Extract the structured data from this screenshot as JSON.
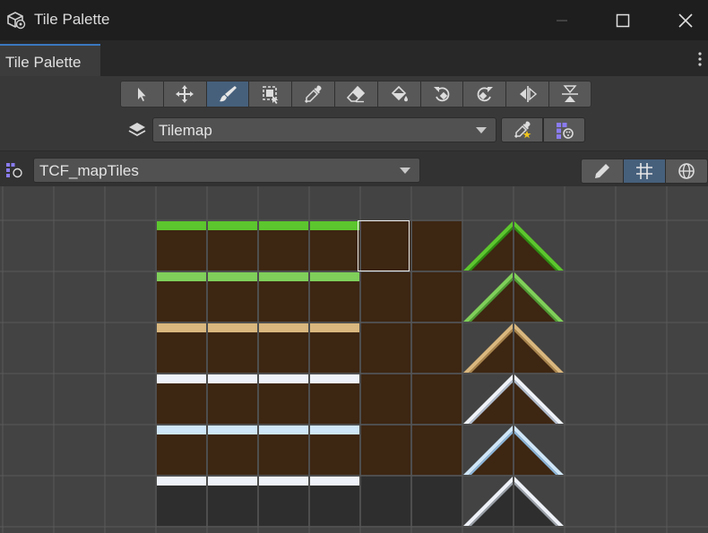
{
  "window": {
    "title": "Tile Palette",
    "controls": {
      "minimize_icon": "minimize-icon",
      "maximize_icon": "maximize-icon",
      "close_icon": "close-icon"
    }
  },
  "tab": {
    "label": "Tile Palette",
    "menu_icon": "kebab-menu-icon"
  },
  "toolbar": {
    "tools": [
      {
        "name": "select-tool",
        "icon": "arrow-cursor-icon"
      },
      {
        "name": "move-tool",
        "icon": "move-arrows-icon"
      },
      {
        "name": "paint-tool",
        "icon": "paintbrush-icon",
        "active": true
      },
      {
        "name": "box-fill-tool",
        "icon": "box-fill-icon"
      },
      {
        "name": "picker-tool",
        "icon": "eyedropper-icon"
      },
      {
        "name": "erase-tool",
        "icon": "eraser-icon"
      },
      {
        "name": "fill-tool",
        "icon": "paint-bucket-icon"
      },
      {
        "name": "rotate-ccw-tool",
        "icon": "rotate-ccw-icon"
      },
      {
        "name": "rotate-cw-tool",
        "icon": "rotate-cw-icon"
      },
      {
        "name": "flip-x-tool",
        "icon": "flip-horizontal-icon"
      },
      {
        "name": "flip-y-tool",
        "icon": "flip-vertical-icon"
      }
    ]
  },
  "tilemap": {
    "selected": "Tilemap",
    "layer_icon": "layers-icon"
  },
  "palette": {
    "selected": "TCF_mapTiles",
    "edit_icon": "pencil-icon",
    "grid_icon": "grid-icon",
    "gizmo_icon": "gizmo-globe-icon"
  },
  "tile_rows": [
    {
      "theme": "grass",
      "surface": "#5cc62e",
      "edge": "#2e8a12"
    },
    {
      "theme": "pale-grass",
      "surface": "#7fcf5a",
      "edge": "#4e9a34"
    },
    {
      "theme": "sand",
      "surface": "#d9b77e",
      "edge": "#a8844e"
    },
    {
      "theme": "snow",
      "surface": "#eef2f8",
      "edge": "#b0bccd"
    },
    {
      "theme": "ice",
      "surface": "#cfe6f8",
      "edge": "#8ab4d8"
    },
    {
      "theme": "stone-snow",
      "surface": "#eef2f8",
      "edge": "#9aa0a8"
    }
  ],
  "colors": {
    "dirt": "#6b4524",
    "dirt_dark": "#3d2612",
    "rock": "#8a5a30",
    "stone": "#5e5e5e",
    "stone_dark": "#2e2e2e",
    "grid_line": "#5a5a5a",
    "active_accent": "#46607c"
  }
}
